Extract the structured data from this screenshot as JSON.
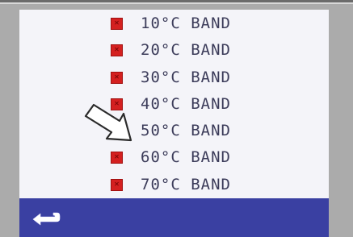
{
  "bands": [
    {
      "label": "10°C BAND",
      "checked": false
    },
    {
      "label": "20°C BAND",
      "checked": false
    },
    {
      "label": "30°C BAND",
      "checked": false
    },
    {
      "label": "40°C BAND",
      "checked": false
    },
    {
      "label": "50°C BAND",
      "checked": true
    },
    {
      "label": "60°C BAND",
      "checked": false
    },
    {
      "label": "70°C BAND",
      "checked": false
    }
  ],
  "icons": {
    "unchecked": "x-mark-icon",
    "checked": "check-mark-icon",
    "back": "return-arrow-icon",
    "pointer": "arrow-cursor-icon"
  },
  "colors": {
    "background": "#f4f4f9",
    "bottom_bar": "#3a40a2",
    "unchecked_box": "#d42020",
    "checked_box": "#22d022",
    "text": "#3c3c5a"
  }
}
